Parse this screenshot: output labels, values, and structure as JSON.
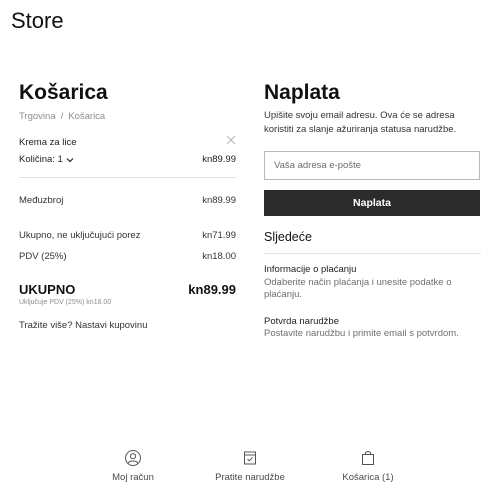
{
  "store_title": "Store",
  "cart": {
    "title": "Košarica",
    "breadcrumb": {
      "home": "Trgovina",
      "separator": "/",
      "current": "Košarica"
    },
    "item": {
      "name": "Krema za lice",
      "quantity_label": "Količina: 1",
      "price": "kn89.99"
    },
    "subtotal": {
      "label": "Međuzbroj",
      "value": "kn89.99"
    },
    "net": {
      "label": "Ukupno, ne uključujući porez",
      "value": "kn71.99"
    },
    "vat": {
      "label": "PDV (25%)",
      "value": "kn18.00"
    },
    "total": {
      "label": "UKUPNO",
      "value": "kn89.99",
      "note": "Uključuje PDV (25%) kn18.00"
    },
    "continue_text": "Tražite više? Nastavi kupovinu"
  },
  "checkout": {
    "title": "Naplata",
    "description": "Upišite svoju email adresu. Ova će se adresa koristiti za slanje ažuriranja statusa narudžbe.",
    "email_placeholder": "Vaša adresa e-pošte",
    "email_value": "",
    "button_label": "Naplata",
    "next_heading": "Sljedeće",
    "steps": [
      {
        "title": "Informacije o plaćanju",
        "desc": "Odaberite način plaćanja i unesite podatke o plaćanju."
      },
      {
        "title": "Potvrda narudžbe",
        "desc": "Postavite narudžbu i primite email s potvrdom."
      }
    ]
  },
  "bottom_nav": [
    {
      "label": "Moj račun",
      "icon": "account-icon"
    },
    {
      "label": "Pratite narudžbe",
      "icon": "track-order-icon"
    },
    {
      "label": "Košarica (1)",
      "icon": "shopping-bag-icon"
    }
  ]
}
